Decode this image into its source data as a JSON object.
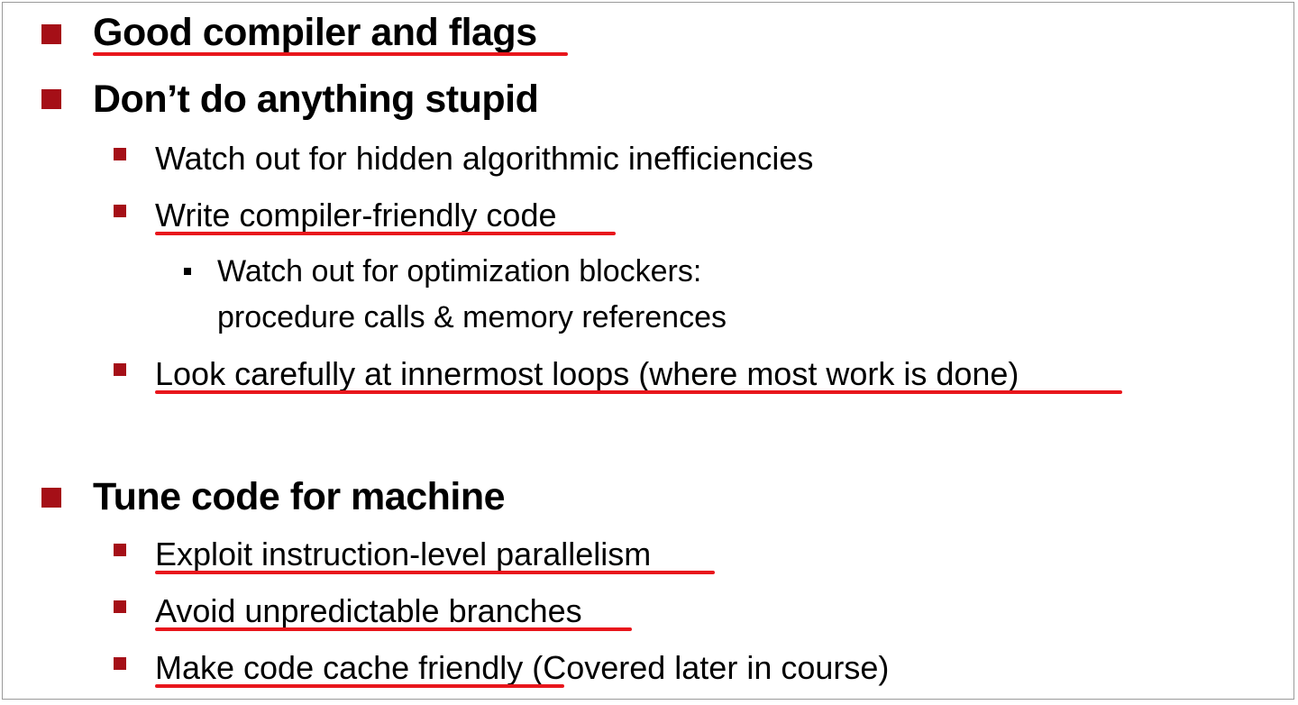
{
  "bullets": [
    {
      "text": "Good compiler and flags",
      "underlined": true
    },
    {
      "text": "Don’t do anything stupid",
      "underlined": false
    },
    {
      "text": "Watch out for hidden algorithmic inefficiencies",
      "underlined": false
    },
    {
      "text": "Write compiler-friendly code",
      "underlined": true
    },
    {
      "line1": "Watch out for optimization blockers:",
      "line2": "procedure calls & memory references"
    },
    {
      "text": "Look carefully at innermost loops (where most work is done)",
      "underlined": true
    },
    {
      "text": "Tune code for machine",
      "underlined": false
    },
    {
      "text": "Exploit instruction-level parallelism",
      "underlined": true
    },
    {
      "text": "Avoid unpredictable branches",
      "underlined": true
    },
    {
      "text_underlined": "Make code cache friendly",
      "text_rest": " (Covered later in course)"
    }
  ],
  "colors": {
    "bullet": "#a50f17",
    "underline": "#e8161c",
    "text": "#000000"
  }
}
